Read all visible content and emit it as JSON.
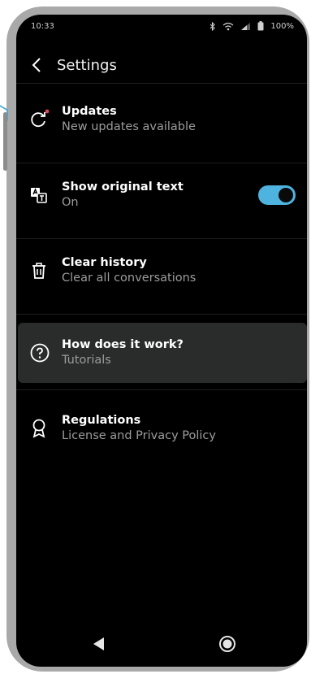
{
  "status_bar": {
    "time": "10:33",
    "battery": "100%"
  },
  "header": {
    "title": "Settings"
  },
  "settings": {
    "items": [
      {
        "title": "Updates",
        "subtitle": "New updates available",
        "icon": "refresh-icon"
      },
      {
        "title": "Show original text",
        "subtitle": "On",
        "icon": "translate-icon",
        "toggle_on": true
      },
      {
        "title": "Clear history",
        "subtitle": "Clear all conversations",
        "icon": "trash-icon"
      },
      {
        "title": "How does it work?",
        "subtitle": "Tutorials",
        "icon": "help-circle-icon"
      },
      {
        "title": "Regulations",
        "subtitle": "License and Privacy Policy",
        "icon": "award-icon"
      }
    ]
  },
  "colors": {
    "accent": "#4fb3e0",
    "badge": "#e0455a",
    "highlight": "#2a2b2b"
  }
}
